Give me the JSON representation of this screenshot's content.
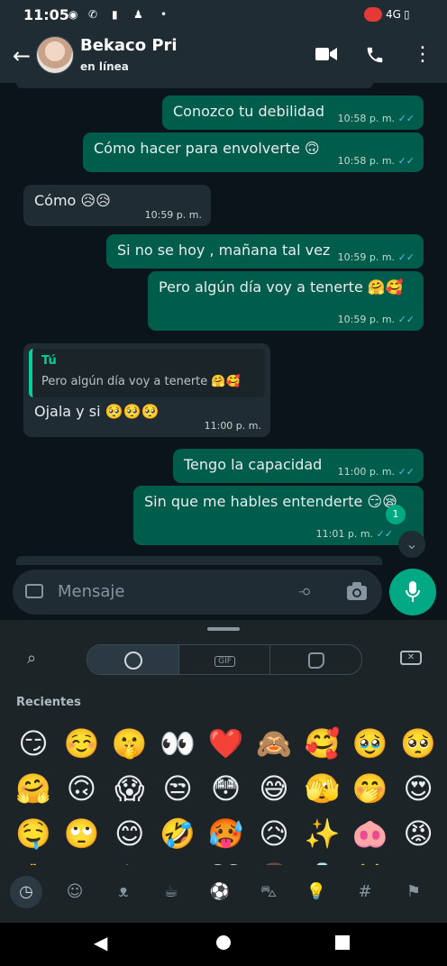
{
  "status_bar": {
    "time": "11:05",
    "network": "4G"
  },
  "header": {
    "contact_name": "Bekaco Pri",
    "presence": "en línea"
  },
  "messages": [
    {
      "direction": "out",
      "text": "Conozco tu debilidad",
      "time": "10:58 p. m.",
      "read": true
    },
    {
      "direction": "out",
      "text": "Cómo hacer para envolverte 🙃",
      "time": "10:58 p. m.",
      "read": true
    },
    {
      "direction": "in",
      "text": "Cómo 😥😥",
      "time": "10:59 p. m."
    },
    {
      "direction": "out",
      "text": "Si no se hoy , mañana tal vez",
      "time": "10:59 p. m.",
      "read": true
    },
    {
      "direction": "out",
      "text": "Pero algún día voy a tenerte 🤗🥰",
      "time": "10:59 p. m.",
      "read": true
    },
    {
      "direction": "in",
      "quote_author": "Tú",
      "quote_text": "Pero algún día voy a tenerte 🤗🥰",
      "text": "Ojala y si 🥺🥺🥺",
      "time": "11:00 p. m."
    },
    {
      "direction": "out",
      "text": "Tengo la capacidad",
      "time": "11:00 p. m.",
      "read": true
    },
    {
      "direction": "out",
      "text": "Sin que me hables entenderte 😏😪",
      "time": "11:01 p. m.",
      "read": true
    }
  ],
  "unread_count": "1",
  "input": {
    "placeholder": "Mensaje"
  },
  "keyboard": {
    "tabs": [
      "emoji",
      "GIF",
      "sticker"
    ],
    "section_title": "Recientes",
    "recent_emojis": [
      "😏",
      "☺️",
      "🤫",
      "👀",
      "❤️",
      "🙈",
      "🥰",
      "🥹",
      "🥺",
      "🤗",
      "🙃",
      "😱",
      "😒",
      "😳",
      "😅",
      "🫣",
      "🤭",
      "😍",
      "🤤",
      "🙄",
      "😊",
      "🤣",
      "🥵",
      "😥",
      "✨",
      "🐽",
      "😡",
      "🙏",
      "😣",
      "👉",
      "😏",
      "🤍",
      "👩",
      "💍",
      "👑",
      "😭"
    ]
  },
  "colors": {
    "outgoing_bubble": "#005c4b",
    "incoming_bubble": "#202c33",
    "accent": "#00a884",
    "read_ticks": "#53bdeb"
  }
}
